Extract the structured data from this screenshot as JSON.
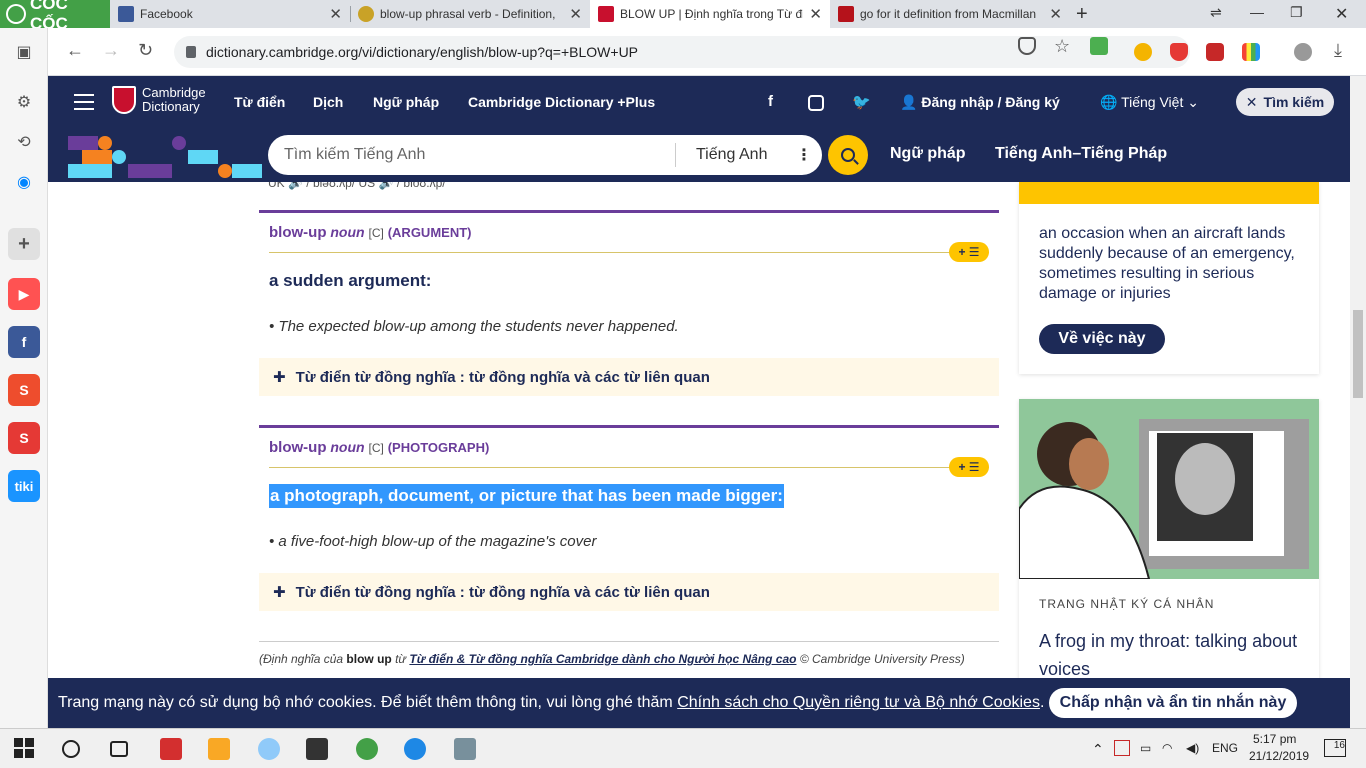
{
  "browser": {
    "brand": "CỐC CỐC",
    "tabs": [
      {
        "title": "Facebook"
      },
      {
        "title": "blow-up phrasal verb - Definition,"
      },
      {
        "title": "BLOW UP | Định nghĩa trong Từ đi"
      },
      {
        "title": "go for it definition from Macmillan"
      }
    ],
    "url": "dictionary.cambridge.org/vi/dictionary/english/blow-up?q=+BLOW+UP"
  },
  "header": {
    "logo_line1": "Cambridge",
    "logo_line2": "Dictionary",
    "nav": [
      "Từ điển",
      "Dịch",
      "Ngữ pháp",
      "Cambridge Dictionary +Plus"
    ],
    "login": "Đăng nhập / Đăng ký",
    "language": "Tiếng Việt",
    "search_toggle": "Tìm kiếm"
  },
  "searchbar": {
    "placeholder": "Tìm kiếm Tiếng Anh",
    "lang": "Tiếng Anh",
    "links": [
      "Ngữ pháp",
      "Tiếng Anh–Tiếng Pháp"
    ]
  },
  "content": {
    "pron_cut": "UK 🔊  / bləʊ.ʌp/  US 🔊  / bloʊ.ʌp/",
    "entries": [
      {
        "headword": "blow-up",
        "pos": "noun",
        "gram": "[C]",
        "guide": "(ARGUMENT)",
        "definition": "a sudden argument:",
        "example": "The expected blow-up among the students never happened.",
        "thesaurus": "Từ điển từ đồng nghĩa : từ đồng nghĩa và các từ liên quan"
      },
      {
        "headword": "blow-up",
        "pos": "noun",
        "gram": "[C]",
        "guide": "(PHOTOGRAPH)",
        "definition": "a photograph, document, or picture that has been made bigger:",
        "example": "a five-foot-high blow-up of the magazine's cover",
        "thesaurus": "Từ điển từ đồng nghĩa : từ đồng nghĩa và các từ liên quan"
      }
    ],
    "credit_prefix": "(Định nghĩa của",
    "credit_word": "blow up",
    "credit_mid": "từ",
    "credit_link": "Từ điển & Từ đồng nghĩa Cambridge dành cho Người học Nâng cao",
    "credit_suffix": "© Cambridge University Press)"
  },
  "sidebar": {
    "ad_text": "an occasion when an aircraft lands suddenly because of an emergency, sometimes resulting in serious damage or injuries",
    "ad_button": "Về việc này",
    "blog_category": "TRANG NHẬT KÝ CÁ NHÂN",
    "blog_title": "A frog in my throat: talking about voices"
  },
  "cookie": {
    "text": "Trang mạng này có sử dụng bộ nhớ cookies. Để biết thêm thông tin, vui lòng ghé thăm",
    "link": "Chính sách cho Quyền riêng tư và Bộ nhớ Cookies",
    "button": "Chấp nhận và ẩn tin nhắn này"
  },
  "taskbar": {
    "lang": "ENG",
    "time": "5:17 pm",
    "date": "21/12/2019",
    "notif": "16"
  },
  "colors": {
    "navy": "#1d2a57",
    "purple": "#6a3d9a",
    "yellow": "#fec400",
    "highlight": "#3297fd"
  }
}
